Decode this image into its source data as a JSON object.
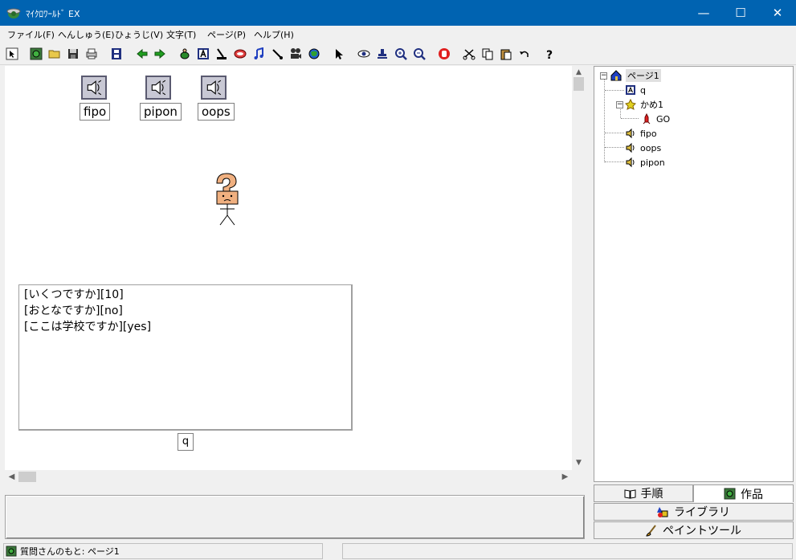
{
  "window": {
    "title": "ﾏｲｸﾛﾜｰﾙﾄﾞ EX",
    "minimize": "—",
    "maximize": "☐",
    "close": "✕"
  },
  "menu": [
    "ファイル(F)",
    "へんしゅう(E)",
    "ひょうじ(V)",
    "文字(T)",
    "ページ(P)",
    "ヘルプ(H)"
  ],
  "toolbar": [
    "pointer-arrow-icon",
    "world-icon",
    "open-folder-icon",
    "save-disk-icon",
    "print-icon",
    "film-icon",
    "back-arrow-icon",
    "forward-arrow-icon",
    "turtle-icon",
    "text-a-icon",
    "paint-icon",
    "button-icon",
    "music-icon",
    "brush-icon",
    "movie-camera-icon",
    "globe-icon",
    "select-arrow-icon",
    "eye-icon",
    "stamp-icon",
    "zoom-in-icon",
    "zoom-out-icon",
    "stop-hand-icon",
    "cut-icon",
    "copy-icon",
    "paste-icon",
    "undo-icon",
    "help-icon"
  ],
  "canvas": {
    "sounds": [
      {
        "name": "fipo"
      },
      {
        "name": "pipon"
      },
      {
        "name": "oops"
      }
    ],
    "textbox_lines": [
      "[いくつですか][10]",
      "[おとなですか][no]",
      "[ここは学校ですか][yes]"
    ],
    "textbox_label": "q"
  },
  "tree": {
    "root": "ページ1",
    "items": [
      {
        "label": "q",
        "icon": "text-a-icon"
      },
      {
        "label": "かめ1",
        "icon": "turtle-icon"
      },
      {
        "label": "GO",
        "icon": "rocket-icon"
      },
      {
        "label": "fipo",
        "icon": "speaker-icon"
      },
      {
        "label": "oops",
        "icon": "speaker-icon"
      },
      {
        "label": "pipon",
        "icon": "speaker-icon"
      }
    ]
  },
  "panel_tabs": {
    "procedure": "手順",
    "works": "作品",
    "library": "ライブラリ",
    "paint_tool": "ペイントツール"
  },
  "status": {
    "left": "質問さんのもと: ページ1",
    "right": ""
  },
  "colors": {
    "titlebar": "#0063b1",
    "canvas": "#ffffff",
    "chrome": "#f0f0f0"
  }
}
